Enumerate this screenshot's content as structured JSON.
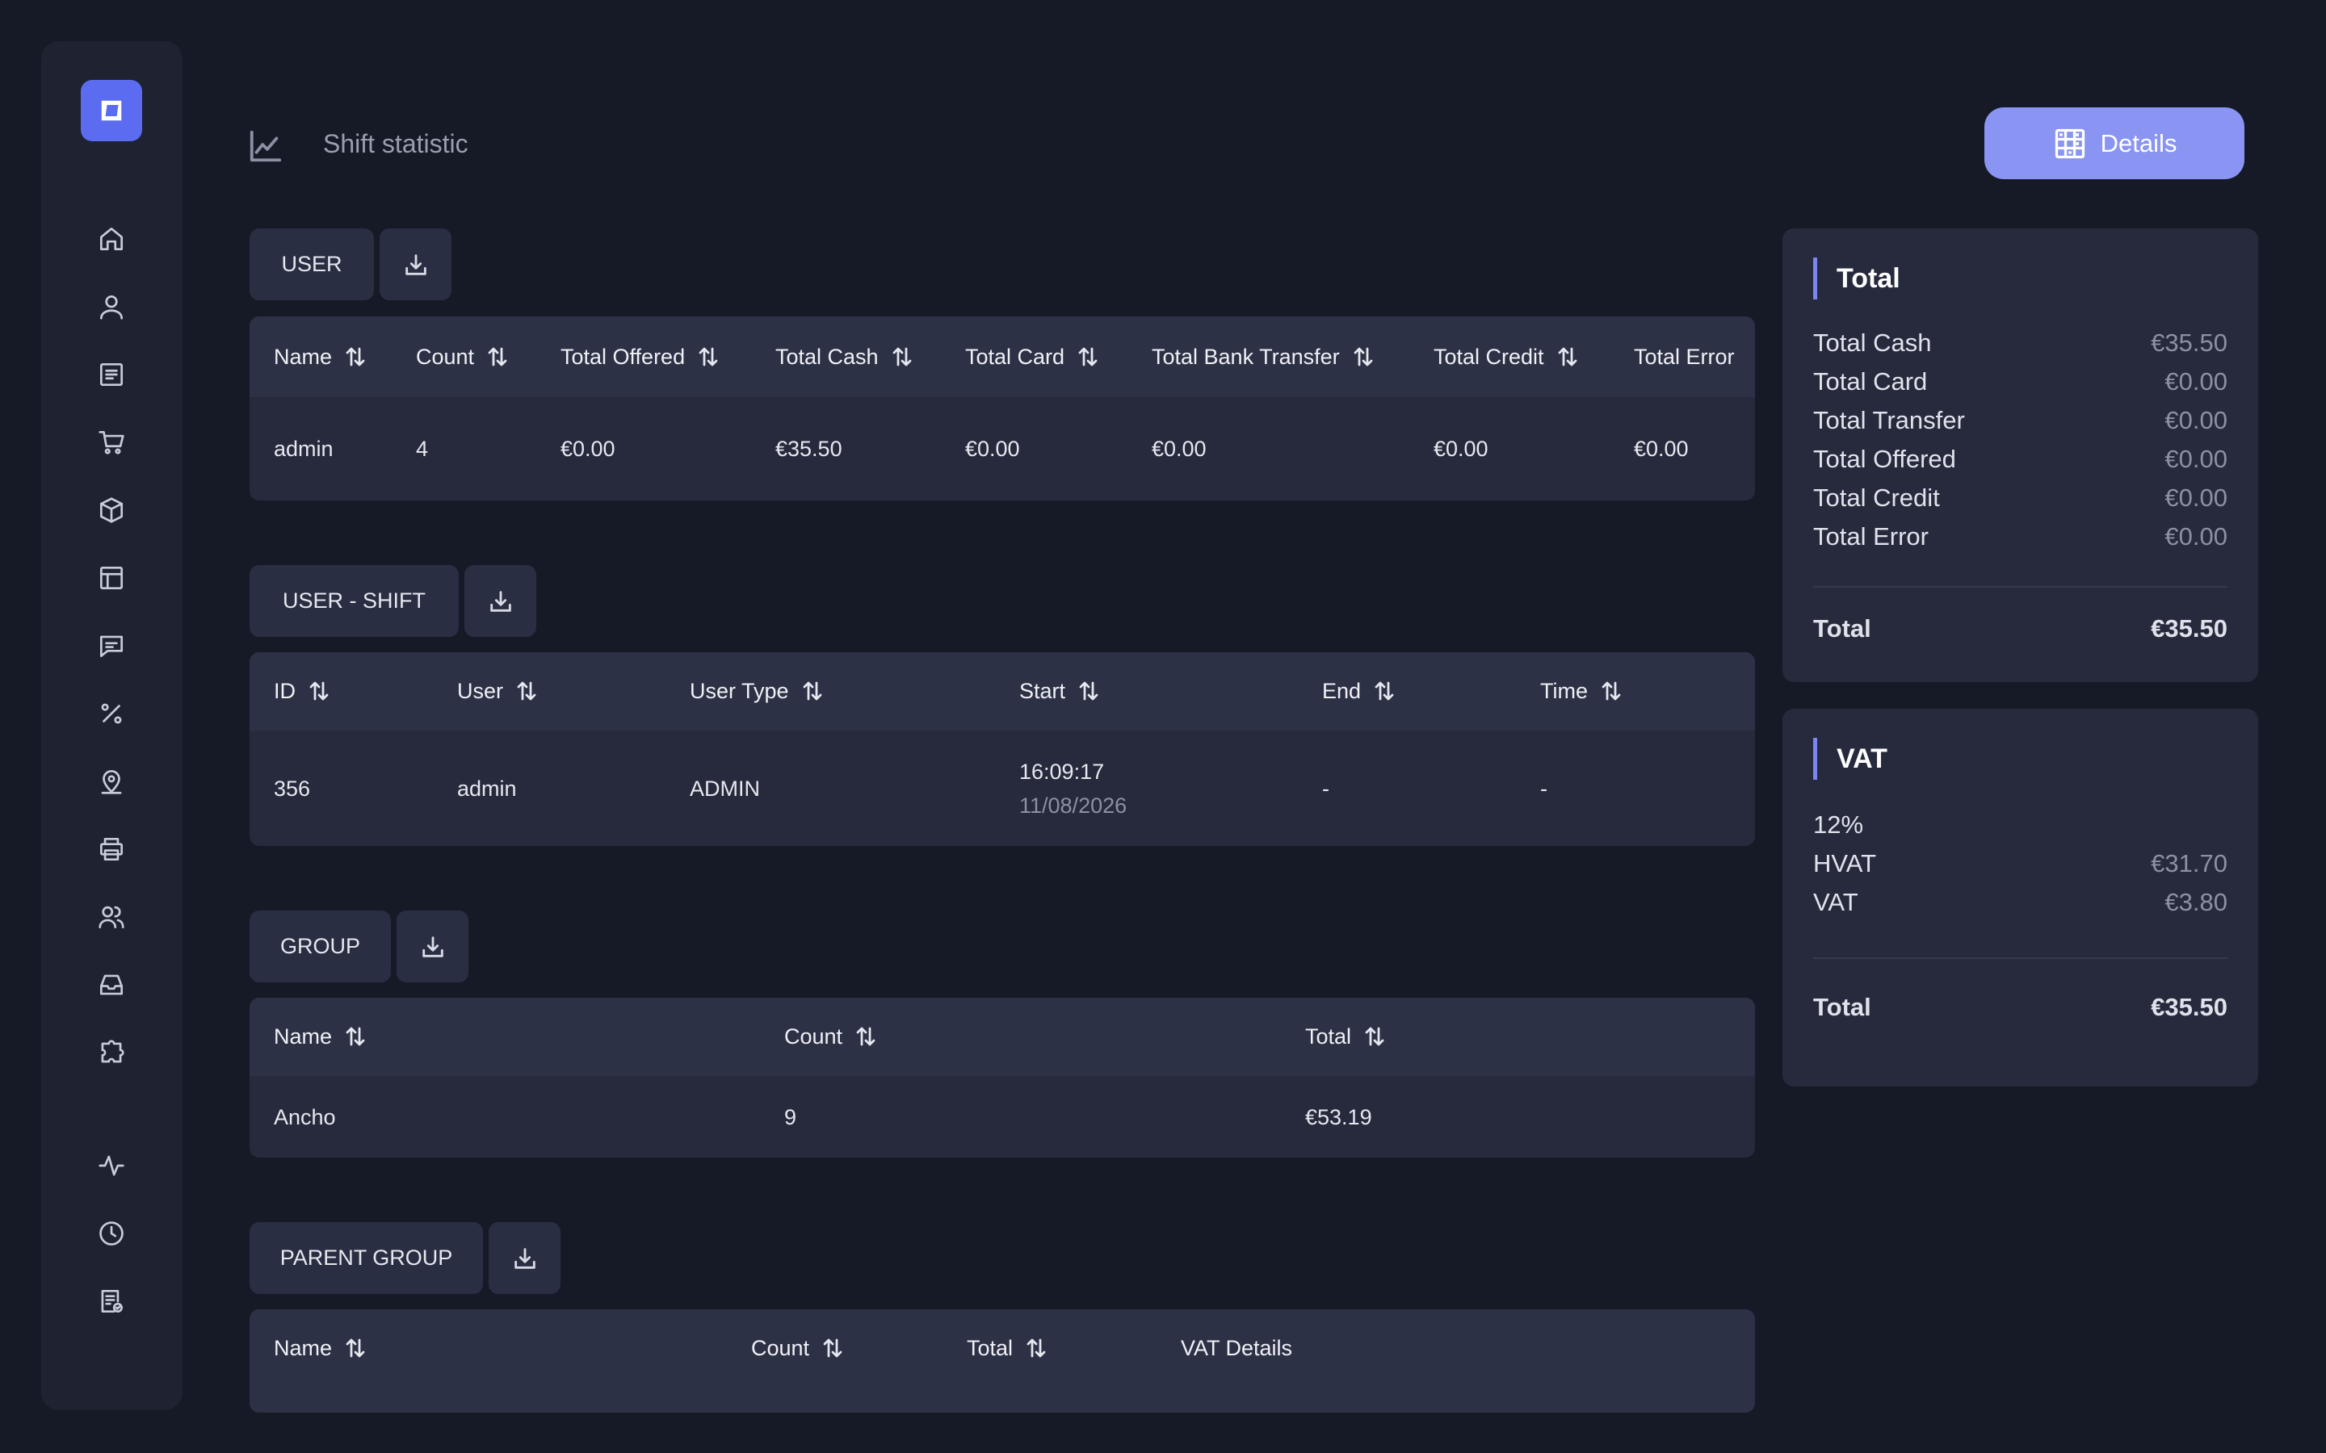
{
  "header": {
    "title": "Shift statistic",
    "details_label": "Details"
  },
  "sidebar": {
    "items": [
      {
        "icon": "home-icon"
      },
      {
        "icon": "user-icon"
      },
      {
        "icon": "receipt-icon"
      },
      {
        "icon": "cart-icon"
      },
      {
        "icon": "box-icon"
      },
      {
        "icon": "table-icon"
      },
      {
        "icon": "chat-icon"
      },
      {
        "icon": "percent-icon"
      },
      {
        "icon": "location-icon"
      },
      {
        "icon": "printer-icon"
      },
      {
        "icon": "users-icon"
      },
      {
        "icon": "inbox-icon"
      },
      {
        "icon": "puzzle-icon"
      },
      {
        "icon": "activity-icon"
      },
      {
        "icon": "clock-icon"
      },
      {
        "icon": "report-icon"
      }
    ]
  },
  "user_section": {
    "tab_label": "USER",
    "columns": [
      "Name",
      "Count",
      "Total Offered",
      "Total Cash",
      "Total Card",
      "Total Bank Transfer",
      "Total Credit",
      "Total Error"
    ],
    "rows": [
      [
        "admin",
        "4",
        "€0.00",
        "€35.50",
        "€0.00",
        "€0.00",
        "€0.00",
        "€0.00"
      ]
    ]
  },
  "user_shift_section": {
    "tab_label": "USER - SHIFT",
    "columns": [
      "ID",
      "User",
      "User Type",
      "Start",
      "End",
      "Time"
    ],
    "rows": [
      {
        "id": "356",
        "user": "admin",
        "user_type": "ADMIN",
        "start_time": "16:09:17",
        "start_date": "11/08/2026",
        "end": "-",
        "time": "-"
      }
    ]
  },
  "group_section": {
    "tab_label": "GROUP",
    "columns": [
      "Name",
      "Count",
      "Total"
    ],
    "rows": [
      [
        "Ancho",
        "9",
        "€53.19"
      ]
    ]
  },
  "parent_group_section": {
    "tab_label": "PARENT GROUP",
    "columns": [
      "Name",
      "Count",
      "Total",
      "VAT Details"
    ]
  },
  "total_panel": {
    "title": "Total",
    "rows": [
      {
        "label": "Total Cash",
        "value": "€35.50"
      },
      {
        "label": "Total Card",
        "value": "€0.00"
      },
      {
        "label": "Total Transfer",
        "value": "€0.00"
      },
      {
        "label": "Total Offered",
        "value": "€0.00"
      },
      {
        "label": "Total Credit",
        "value": "€0.00"
      },
      {
        "label": "Total Error",
        "value": "€0.00"
      }
    ],
    "total_label": "Total",
    "total_value": "€35.50"
  },
  "vat_panel": {
    "title": "VAT",
    "rate": "12%",
    "rows": [
      {
        "label": "HVAT",
        "value": "€31.70"
      },
      {
        "label": "VAT",
        "value": "€3.80"
      }
    ],
    "total_label": "Total",
    "total_value": "€35.50"
  },
  "colors": {
    "background": "#161a26",
    "sidebar": "#1e2231",
    "accent": "#5b6cf0",
    "details_button": "#8994f3",
    "card": "#262a3c"
  }
}
